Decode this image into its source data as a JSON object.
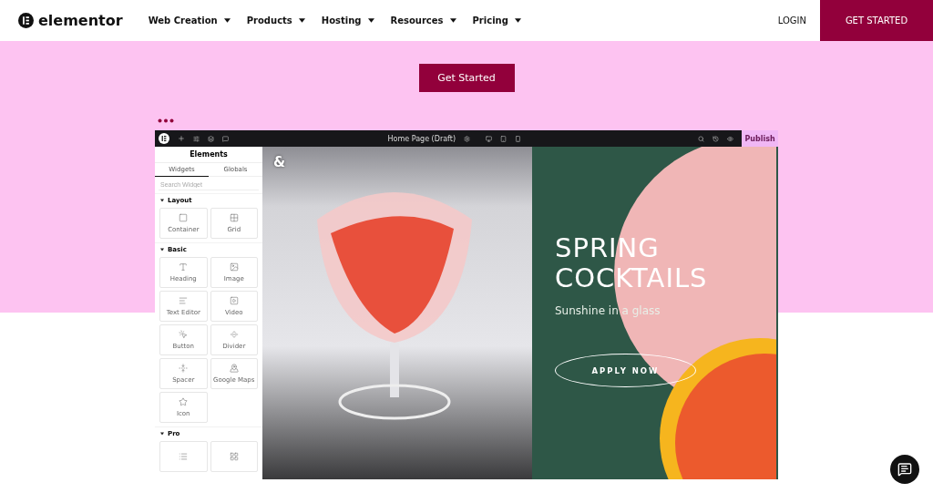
{
  "nav": {
    "logo": "elementor",
    "items": [
      {
        "label": "Web Creation"
      },
      {
        "label": "Products"
      },
      {
        "label": "Hosting"
      },
      {
        "label": "Resources"
      },
      {
        "label": "Pricing"
      }
    ],
    "login": "LOGIN",
    "cta": "GET STARTED"
  },
  "hero": {
    "button": "Get Started"
  },
  "editor": {
    "page_title": "Home Page (Draft)",
    "publish": "Publish",
    "panel_title": "Elements",
    "tabs": [
      {
        "label": "Widgets",
        "selected": true
      },
      {
        "label": "Globals",
        "selected": false
      }
    ],
    "search": {
      "placeholder": "Search Widget"
    },
    "sections": [
      {
        "title": "Layout",
        "expanded": true,
        "widgets": [
          {
            "label": "Container"
          },
          {
            "label": "Grid"
          }
        ]
      },
      {
        "title": "Basic",
        "expanded": true,
        "widgets": [
          {
            "label": "Heading"
          },
          {
            "label": "Image"
          },
          {
            "label": "Text Editor"
          },
          {
            "label": "Video"
          },
          {
            "label": "Button"
          },
          {
            "label": "Divider"
          },
          {
            "label": "Spacer"
          },
          {
            "label": "Google Maps"
          },
          {
            "label": "Icon"
          }
        ]
      },
      {
        "title": "Pro",
        "expanded": true
      }
    ],
    "canvas": {
      "mark": "&",
      "heading_lines": [
        "SPRING",
        "COCKTAILS"
      ],
      "subtitle": "Sunshine in a glass",
      "button": "APPLY NOW"
    }
  }
}
